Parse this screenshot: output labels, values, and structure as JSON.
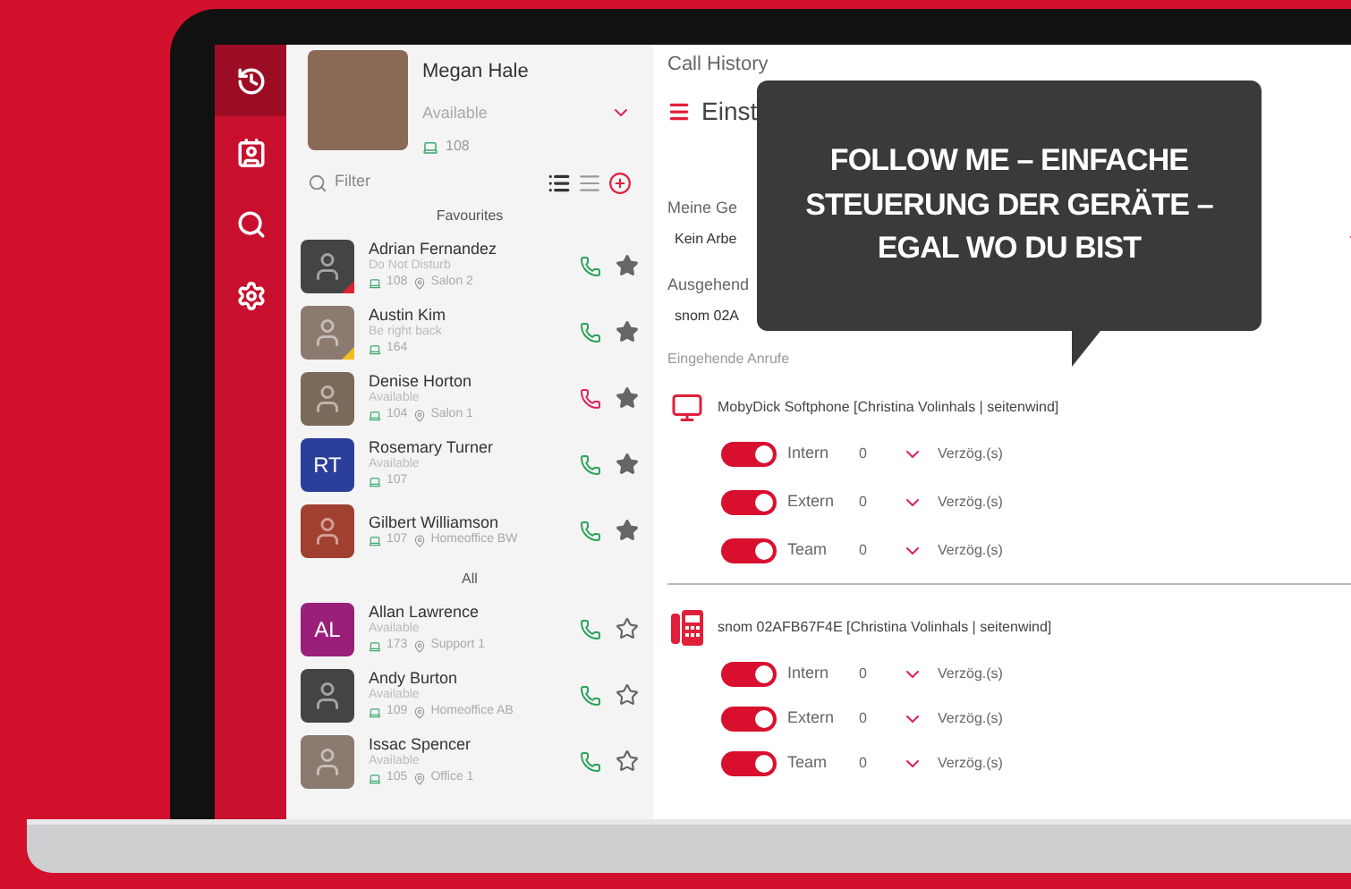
{
  "sidebar": {
    "items": [
      {
        "selected": true
      },
      {
        "selected": false
      },
      {
        "selected": false
      },
      {
        "selected": false
      }
    ]
  },
  "user": {
    "name": "Megan Hale",
    "status": "Available",
    "extension": "108"
  },
  "filter": {
    "placeholder": "Filter"
  },
  "contact_groups": [
    {
      "title": "Favourites",
      "contacts": [
        {
          "name": "Adrian Fernandez",
          "status": "Do Not Disturb",
          "extension": "108",
          "location": "Salon 2",
          "kind": "photo",
          "badge": {
            "color": "#e0202f"
          },
          "color": "#2aa35a",
          "favourite": true
        },
        {
          "name": "Austin Kim",
          "status": "Be right back",
          "extension": "164",
          "kind": "photo",
          "badge": {
            "color": "#f2c01e"
          },
          "color": "#2aa35a",
          "favourite": true
        },
        {
          "name": "Denise Horton",
          "status": "Available",
          "extension": "104",
          "location": "Salon 1",
          "kind": "photo",
          "color": "#e0205a",
          "favourite": true
        },
        {
          "name": "Rosemary Turner",
          "status": "Available",
          "extension": "107",
          "kind": "initials",
          "initials": "RT",
          "avatar": {
            "color": "#2a3f9a"
          },
          "color": "#2aa35a",
          "favourite": true
        },
        {
          "name": "Gilbert Williamson",
          "extension": "107",
          "location": "Homeoffice BW",
          "kind": "photo",
          "color": "#2aa35a",
          "favourite": true
        }
      ]
    },
    {
      "title": "All",
      "contacts": [
        {
          "name": "Allan Lawrence",
          "status": "Available",
          "extension": "173",
          "location": "Support 1",
          "kind": "initials",
          "initials": "AL",
          "avatar": {
            "color": "#9a1f7a"
          },
          "color": "#2aa35a",
          "favourite": false
        },
        {
          "name": "Andy Burton",
          "status": "Available",
          "extension": "109",
          "location": "Homeoffice AB",
          "kind": "photo",
          "color": "#2aa35a",
          "favourite": false
        },
        {
          "name": "Issac Spencer",
          "status": "Available",
          "extension": "105",
          "location": "Office 1",
          "kind": "photo",
          "color": "#2aa35a",
          "favourite": false
        }
      ]
    }
  ],
  "main": {
    "top_title": "Call History",
    "header_title": "Einst",
    "fields": [
      {
        "label": "Meine Ge",
        "value": "Kein Arbe",
        "kind": "more"
      },
      {
        "label": "Ausgehend",
        "value": "snom 02A",
        "kind": "dropdown"
      }
    ],
    "incoming_label": "Eingehende Anrufe",
    "devices": [
      {
        "kind": "monitor",
        "title": "MobyDick Softphone [Christina Volinhals | seitenwind]",
        "rules": [
          {
            "label": "Intern",
            "on": true,
            "delay": "0",
            "unit": "Verzög.(s)"
          },
          {
            "label": "Extern",
            "on": true,
            "delay": "0",
            "unit": "Verzög.(s)"
          },
          {
            "label": "Team",
            "on": true,
            "delay": "0",
            "unit": "Verzög.(s)"
          }
        ]
      },
      {
        "kind": "deskphone",
        "title": "snom 02AFB67F4E [Christina Volinhals | seitenwind]",
        "rules": [
          {
            "label": "Intern",
            "on": true,
            "delay": "0",
            "unit": "Verzög.(s)"
          },
          {
            "label": "Extern",
            "on": true,
            "delay": "0",
            "unit": "Verzög.(s)"
          },
          {
            "label": "Team",
            "on": true,
            "delay": "0",
            "unit": "Verzög.(s)"
          }
        ]
      }
    ]
  },
  "callout": {
    "text": "FOLLOW ME – EINFACHE STEUERUNG DER GERÄTE – EGAL WO DU BIST"
  }
}
